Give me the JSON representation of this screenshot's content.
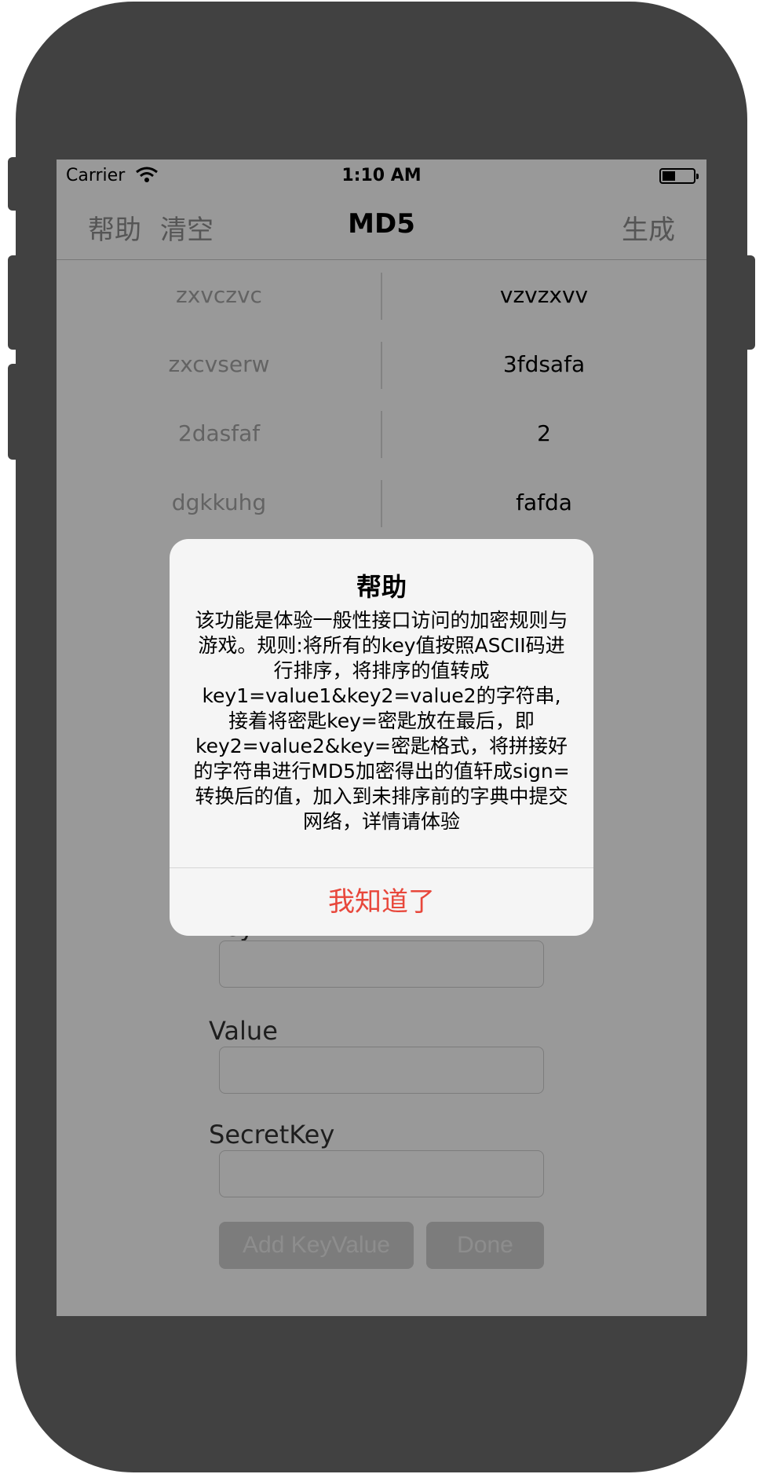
{
  "status_bar": {
    "carrier": "Carrier",
    "time": "1:10 AM",
    "wifi_icon": "wifi-icon",
    "battery_icon": "battery-icon"
  },
  "nav": {
    "help_label": "帮助",
    "clear_label": "清空",
    "title": "MD5",
    "generate_label": "生成"
  },
  "kv_rows": [
    {
      "key": "zxvczvc",
      "value": "vzvzxvv"
    },
    {
      "key": "zxcvserw",
      "value": "3fdsafa"
    },
    {
      "key": "2dasfaf",
      "value": "2"
    },
    {
      "key": "dgkkuhg",
      "value": "fafda"
    }
  ],
  "form": {
    "key_label": "Key",
    "value_label": "Value",
    "secret_label": "SecretKey",
    "key_value": "",
    "value_value": "",
    "secret_value": "",
    "add_button": "Add KeyValue",
    "done_button": "Done"
  },
  "alert": {
    "title": "帮助",
    "message": "该功能是体验一般性接口访问的加密规则与游戏。规则:将所有的key值按照ASCII码进行排序，将排序的值转成key1=value1&key2=value2的字符串,接着将密匙key=密匙放在最后，即key2=value2&key=密匙格式，将拼接好的字符串进行MD5加密得出的值轩成sign=转换后的值，加入到未排序前的字典中提交网络，详情请体验",
    "action": "我知道了",
    "action_color": "#e8473b"
  }
}
